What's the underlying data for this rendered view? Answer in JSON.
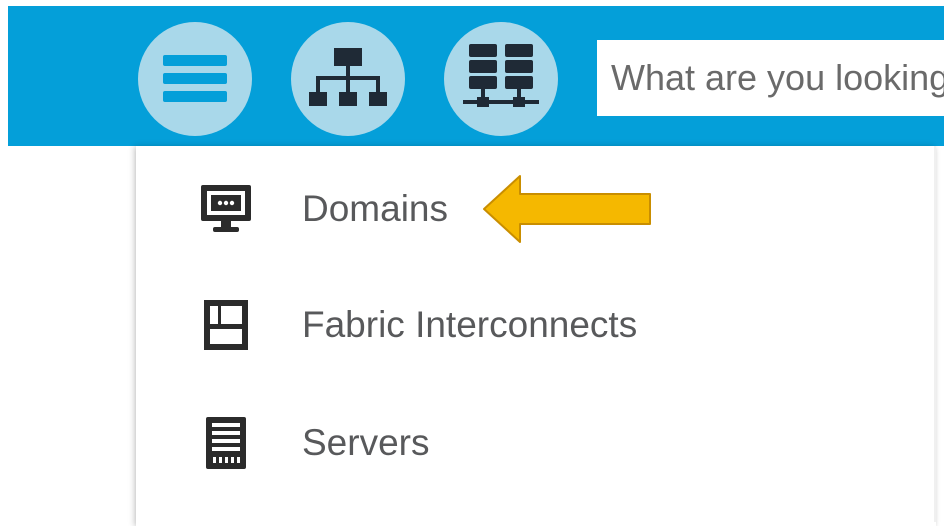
{
  "toolbar": {
    "background_color": "#049fd9",
    "buttons": [
      {
        "icon": "hamburger-menu-icon"
      },
      {
        "icon": "network-topology-icon"
      },
      {
        "icon": "server-rack-network-icon"
      }
    ],
    "search": {
      "placeholder": "What are you looking for?"
    }
  },
  "menu": {
    "items": [
      {
        "label": "Domains",
        "icon": "monitor-icon"
      },
      {
        "label": "Fabric Interconnects",
        "icon": "fabric-interconnect-icon"
      },
      {
        "label": "Servers",
        "icon": "server-icon"
      }
    ]
  },
  "annotation": {
    "arrow_color": "#f5b800",
    "points_to": "Domains"
  }
}
